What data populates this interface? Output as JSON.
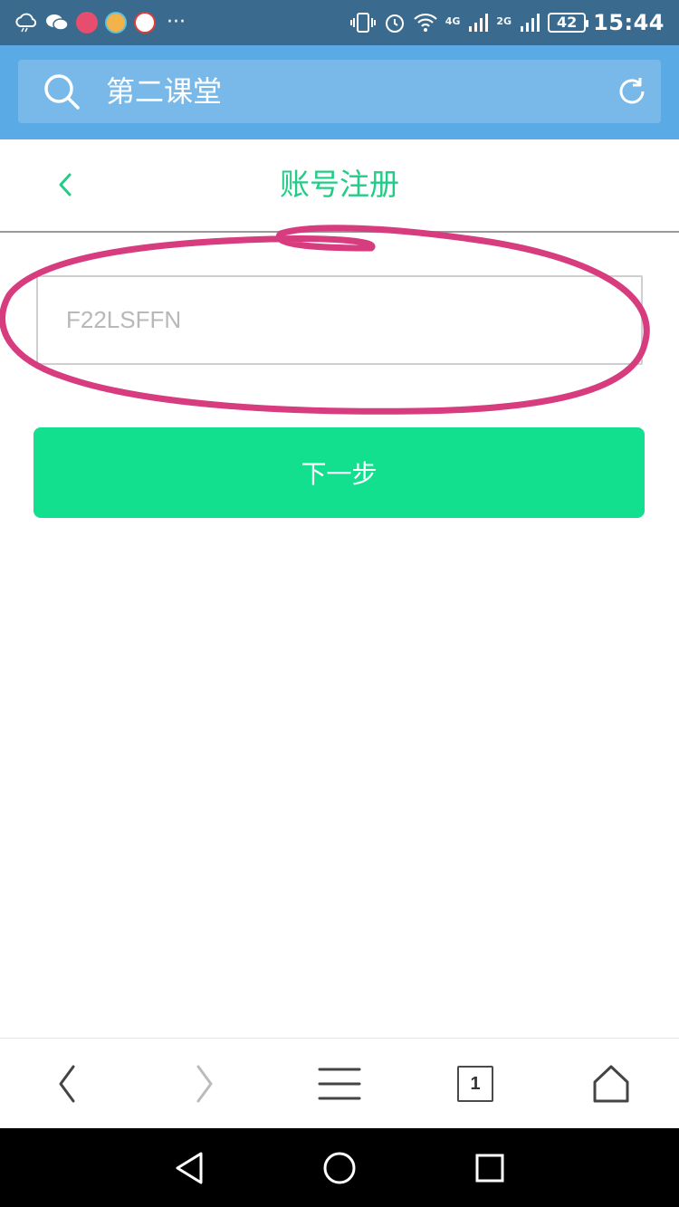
{
  "status_bar": {
    "time": "15:44",
    "battery": "42",
    "network_1": "4G",
    "network_2": "2G"
  },
  "browser": {
    "address_text": "第二课堂",
    "tab_count": "1"
  },
  "page": {
    "title": "账号注册",
    "input_placeholder": "F22LSFFN",
    "input_value": "",
    "next_label": "下一步"
  },
  "colors": {
    "accent": "#22cc86",
    "button": "#12e08e",
    "annotation": "#d63c7e",
    "address_bar": "#5aaae5"
  },
  "icons": {
    "search": "search-icon",
    "refresh": "refresh-icon",
    "back": "chevron-left-icon"
  }
}
